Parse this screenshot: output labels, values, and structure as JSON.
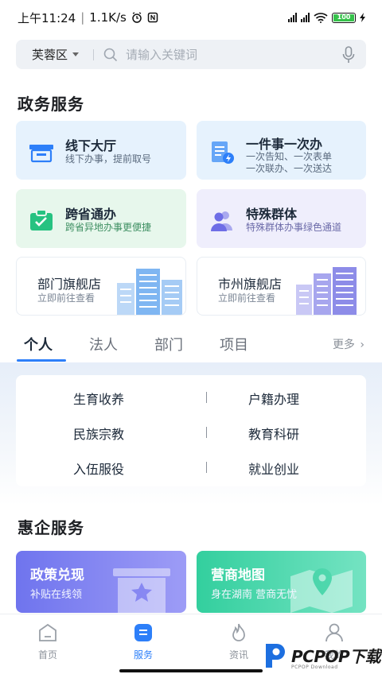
{
  "status_bar": {
    "time": "上午11:24",
    "speed": "1.1K/s",
    "battery": "100"
  },
  "search": {
    "region": "芙蓉区",
    "placeholder": "请输入关键词"
  },
  "gov_services": {
    "title": "政务服务",
    "cards": [
      {
        "title": "线下大厅",
        "sub": "线下办事，提前取号"
      },
      {
        "title": "一件事一次办",
        "sub": "一次告知、一次表单",
        "sub2": "一次联办、一次送达"
      },
      {
        "title": "跨省通办",
        "sub": "跨省异地办事更便捷"
      },
      {
        "title": "特殊群体",
        "sub": "特殊群体办事绿色通道"
      }
    ],
    "stores": [
      {
        "title": "部门旗舰店",
        "sub": "立即前往查看"
      },
      {
        "title": "市州旗舰店",
        "sub": "立即前往查看"
      }
    ]
  },
  "tabs": {
    "items": [
      "个人",
      "法人",
      "部门",
      "项目"
    ],
    "active": "个人",
    "more": "更多"
  },
  "categories": [
    [
      "生育收养",
      "户籍办理"
    ],
    [
      "民族宗教",
      "教育科研"
    ],
    [
      "入伍服役",
      "就业创业"
    ]
  ],
  "enterprise": {
    "title": "惠企服务",
    "promos": [
      {
        "title": "政策兑现",
        "sub": "补贴在线领"
      },
      {
        "title": "营商地图",
        "sub": "身在湖南 营商无忧"
      }
    ]
  },
  "bottom_nav": {
    "items": [
      "首页",
      "服务",
      "资讯",
      "我的"
    ],
    "active": "服务"
  },
  "watermark": {
    "text": "PCPOP下载",
    "sub": "PCPOP Download"
  },
  "colors": {
    "accent": "#2d7ff9",
    "card_blue": "#e6f2fd",
    "card_green": "#e7f7ec",
    "card_purple": "#efeefc",
    "promo_purple": "#7d7cf0",
    "promo_green": "#3dd6a3"
  }
}
